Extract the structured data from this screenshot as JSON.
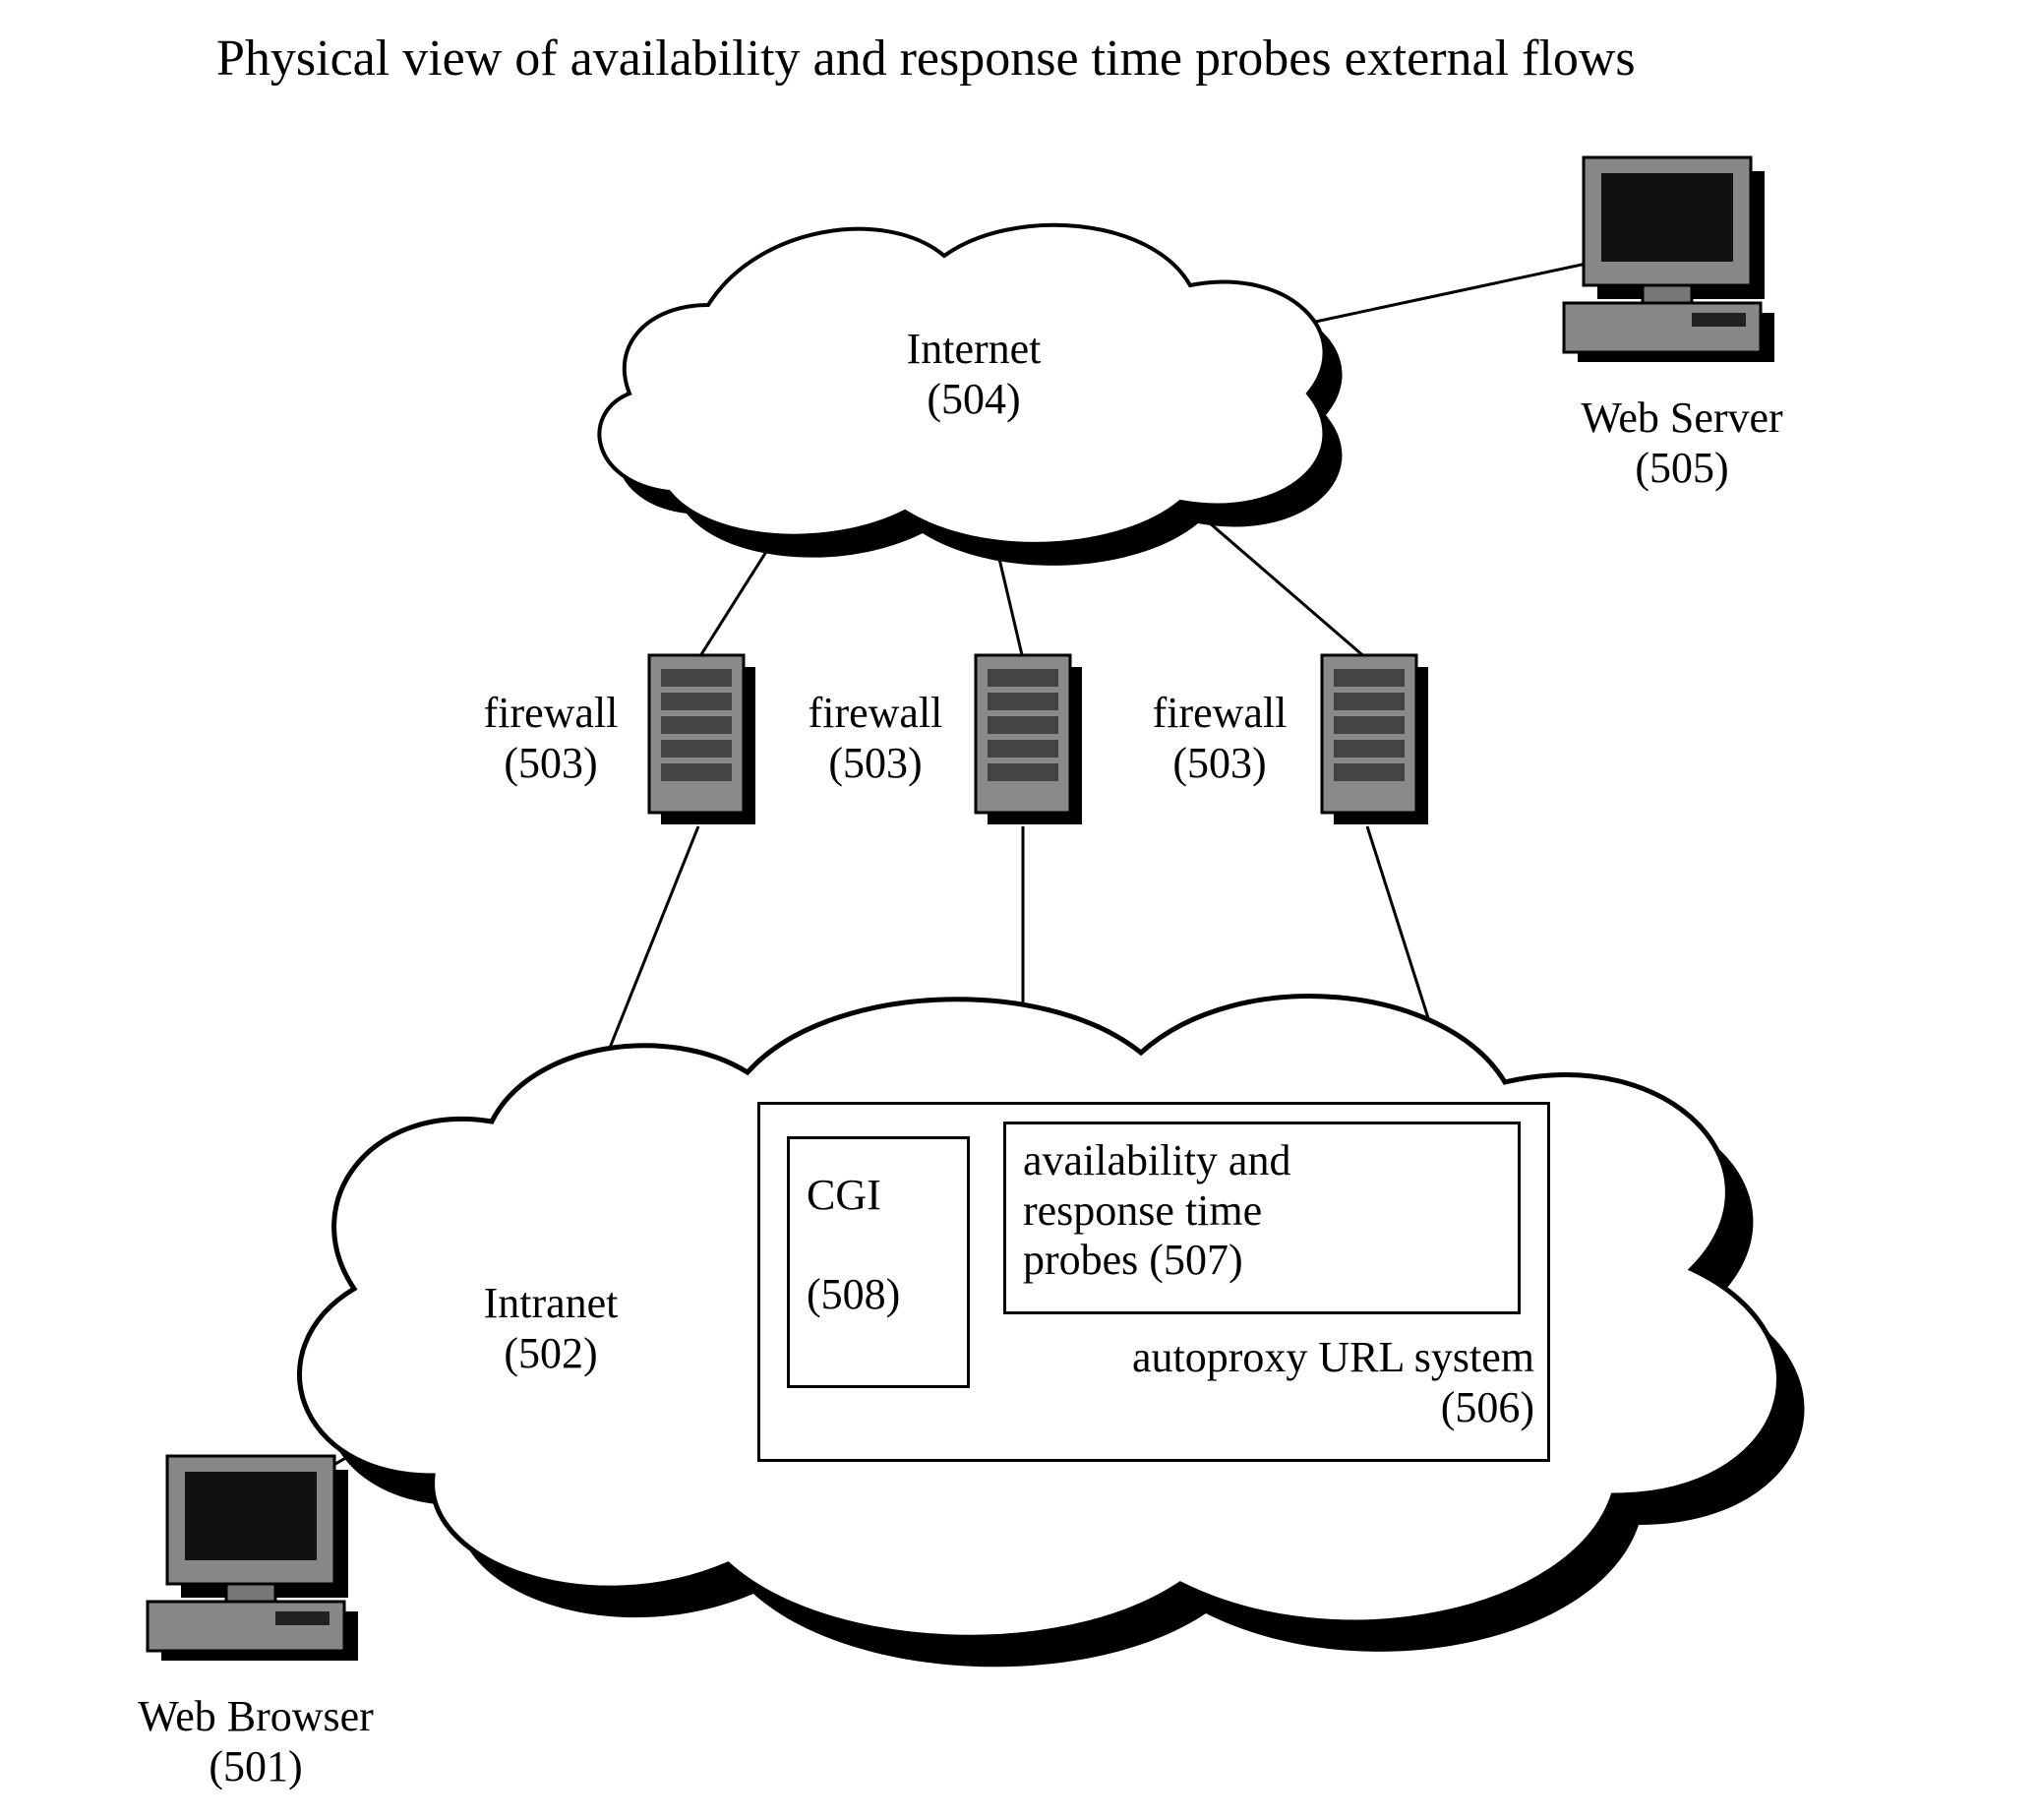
{
  "title": "Physical view of availability and response time probes external flows",
  "nodes": {
    "internet": {
      "label": "Internet\n(504)"
    },
    "intranet": {
      "label": "Intranet\n(502)"
    },
    "webServer": {
      "label": "Web Server\n(505)"
    },
    "webBrowser": {
      "label": "Web Browser\n(501)"
    },
    "firewall1": {
      "label": "firewall\n(503)"
    },
    "firewall2": {
      "label": "firewall\n(503)"
    },
    "firewall3": {
      "label": "firewall\n(503)"
    },
    "autoproxy": {
      "label": "autoproxy URL system\n(506)"
    },
    "cgi": {
      "label": "CGI\n\n(508)"
    },
    "probes": {
      "label": "availability and\nresponse time\nprobes (507)"
    }
  }
}
